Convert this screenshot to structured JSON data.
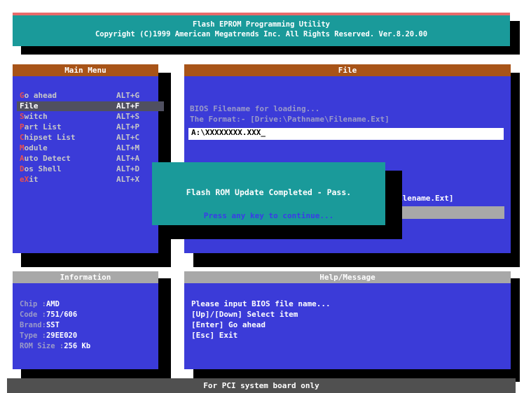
{
  "header": {
    "title": "Flash EPROM Programming Utility",
    "copyright": "Copyright (C)1999 American Megatrends Inc. All Rights Reserved. Ver.8.20.00"
  },
  "main_menu": {
    "title": "Main Menu",
    "items": [
      {
        "hot": "G",
        "rest": "o ahead",
        "key": "ALT+G"
      },
      {
        "hot": "F",
        "rest": "ile",
        "key": "ALT+F"
      },
      {
        "hot": "S",
        "rest": "witch",
        "key": "ALT+S"
      },
      {
        "hot": "P",
        "rest": "art List",
        "key": "ALT+P"
      },
      {
        "hot": "C",
        "rest": "hipset List",
        "key": "ALT+C"
      },
      {
        "hot": "M",
        "rest": "odule",
        "key": "ALT+M"
      },
      {
        "hot": "A",
        "rest": "uto Detect",
        "key": "ALT+A"
      },
      {
        "hot": "D",
        "rest": "os Shell",
        "key": "ALT+D"
      },
      {
        "hot": "e",
        "rest": "X",
        "rest2": "it",
        "key": "ALT+X"
      }
    ],
    "selected_index": 1
  },
  "file_panel": {
    "title": "File",
    "line1": "BIOS Filename for loading...",
    "line2": "The Format:-  [Drive:\\Pathname\\Filename.Ext]",
    "input_value": "A:\\XXXXXXXX.XXX_",
    "partial_format": "ilename.Ext]"
  },
  "dialog": {
    "message": "Flash ROM Update Completed - Pass.",
    "prompt": "Press any key to continue..."
  },
  "information": {
    "title": "Information",
    "rows": [
      {
        "label": "Chip :",
        "value": "AMD"
      },
      {
        "label": "Code :",
        "value": "751/606"
      },
      {
        "label": "Brand:",
        "value": "SST"
      },
      {
        "label": "Type :",
        "value": "29EE020"
      },
      {
        "label": "ROM Size :",
        "value": "256 Kb"
      }
    ]
  },
  "help": {
    "title": "Help/Message",
    "lines": [
      "Please input BIOS file name...",
      "[Up]/[Down] Select item",
      "[Enter] Go ahead",
      "[Esc] Exit"
    ]
  },
  "status_bar": "For PCI system board only",
  "colors": {
    "header_bg": "#1a9a9a",
    "panel_bg": "#3b3bd8",
    "menu_title_bg": "#a85418",
    "hotkey": "#e85050"
  }
}
